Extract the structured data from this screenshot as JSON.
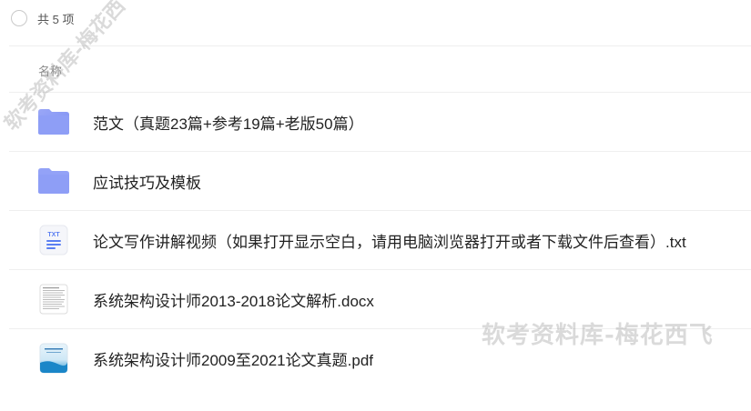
{
  "header": {
    "count_label": "共 5 项"
  },
  "columns": {
    "name_header": "名称"
  },
  "files": [
    {
      "name": "范文（真题23篇+参考19篇+老版50篇）",
      "icon": "folder-icon"
    },
    {
      "name": "应试技巧及模板",
      "icon": "folder-icon"
    },
    {
      "name": "论文写作讲解视频（如果打开显示空白，请用电脑浏览器打开或者下载文件后查看）.txt",
      "icon": "txt-file-icon",
      "icon_label": "TXT"
    },
    {
      "name": "系统架构设计师2013-2018论文解析.docx",
      "icon": "docx-file-icon"
    },
    {
      "name": "系统架构设计师2009至2021论文真题.pdf",
      "icon": "pdf-file-icon"
    }
  ],
  "watermarks": {
    "diagonal": "软考资料库-梅花西飞",
    "horizontal": "软考资料库-梅花西飞"
  },
  "colors": {
    "folder": "#8b9cf6",
    "txt_accent": "#5b7ff2"
  }
}
